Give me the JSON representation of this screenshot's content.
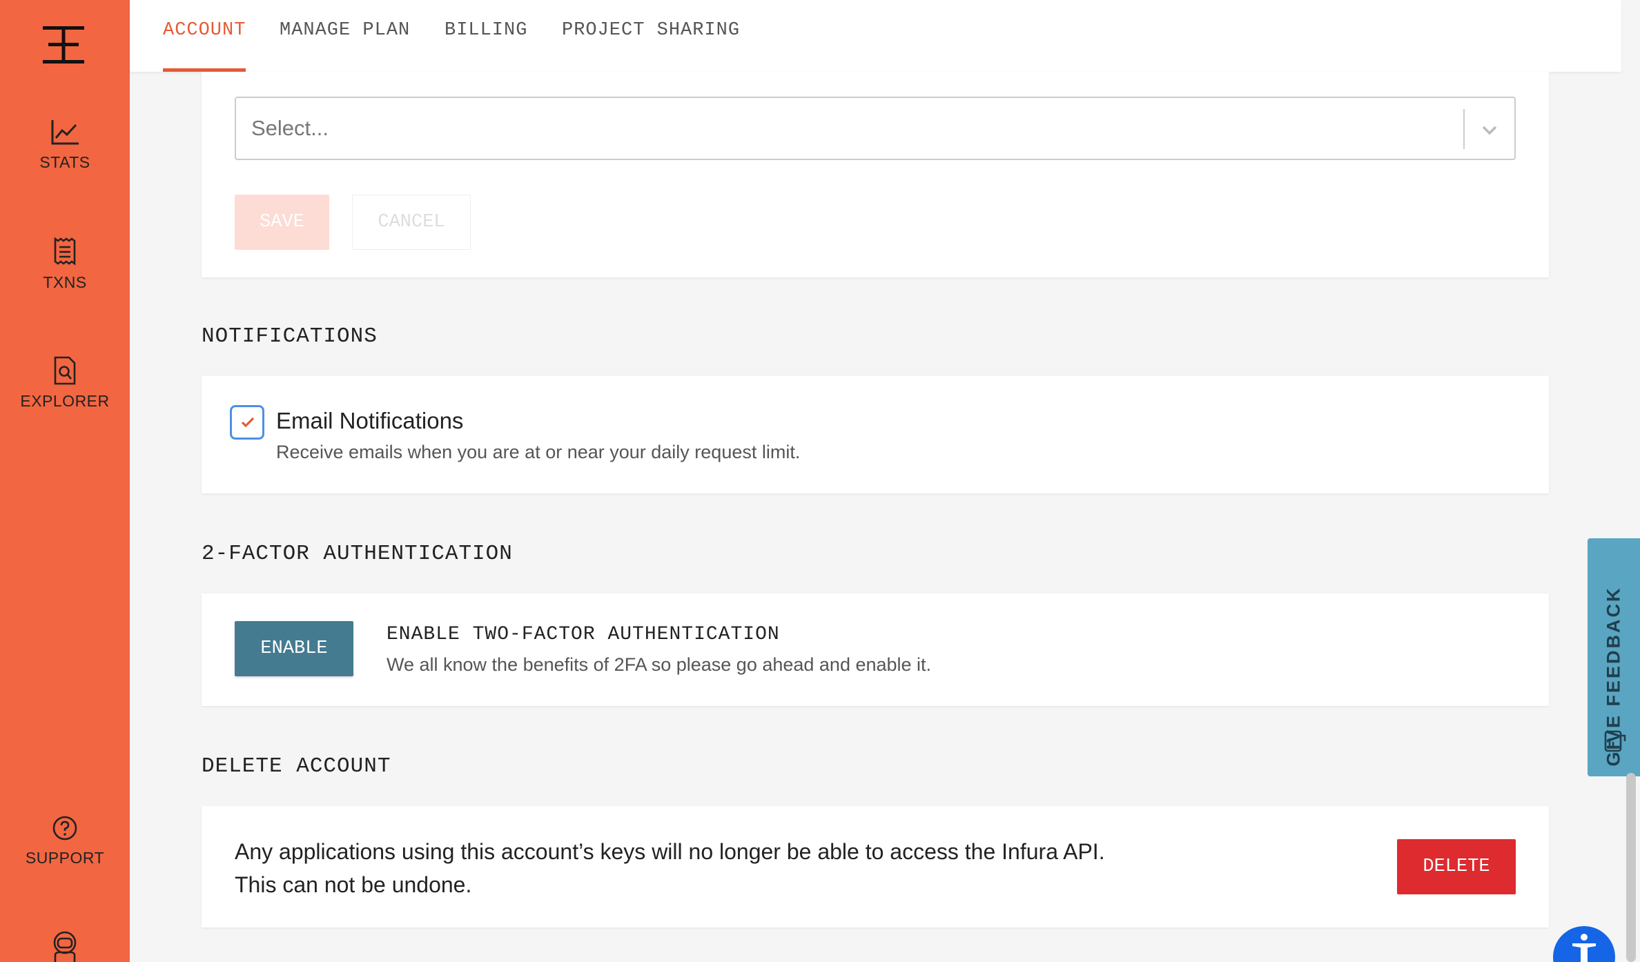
{
  "sidebar": {
    "items": [
      {
        "label": "STATS",
        "icon": "chart-line-icon"
      },
      {
        "label": "TXNS",
        "icon": "receipt-icon"
      },
      {
        "label": "EXPLORER",
        "icon": "file-search-icon"
      },
      {
        "label": "SUPPORT",
        "icon": "help-circle-icon"
      },
      {
        "label": "",
        "icon": "astronaut-icon"
      }
    ]
  },
  "tabs": [
    {
      "label": "ACCOUNT",
      "active": true
    },
    {
      "label": "MANAGE PLAN",
      "active": false
    },
    {
      "label": "BILLING",
      "active": false
    },
    {
      "label": "PROJECT SHARING",
      "active": false
    }
  ],
  "top_card": {
    "select_placeholder": "Select...",
    "save_label": "SAVE",
    "cancel_label": "CANCEL"
  },
  "notifications": {
    "title": "NOTIFICATIONS",
    "email_title": "Email Notifications",
    "email_desc": "Receive emails when you are at or near your daily request limit.",
    "checked": true
  },
  "twofa": {
    "title": "2-FACTOR AUTHENTICATION",
    "enable_label": "ENABLE",
    "heading": "ENABLE TWO-FACTOR AUTHENTICATION",
    "desc": "We all know the benefits of 2FA so please go ahead and enable it."
  },
  "delete_account": {
    "title": "DELETE ACCOUNT",
    "line1": "Any applications using this account’s keys will no longer be able to access the Infura API.",
    "line2": "This can not be undone.",
    "delete_label": "DELETE"
  },
  "feedback": {
    "label": "GIVE FEEDBACK"
  },
  "colors": {
    "sidebar": "#f26641",
    "accent": "#e55b36",
    "enable_button": "#457b91",
    "delete_button": "#dd2b2f",
    "feedback_tab": "#5aa5c2",
    "checkbox_border": "#4a90e2"
  }
}
